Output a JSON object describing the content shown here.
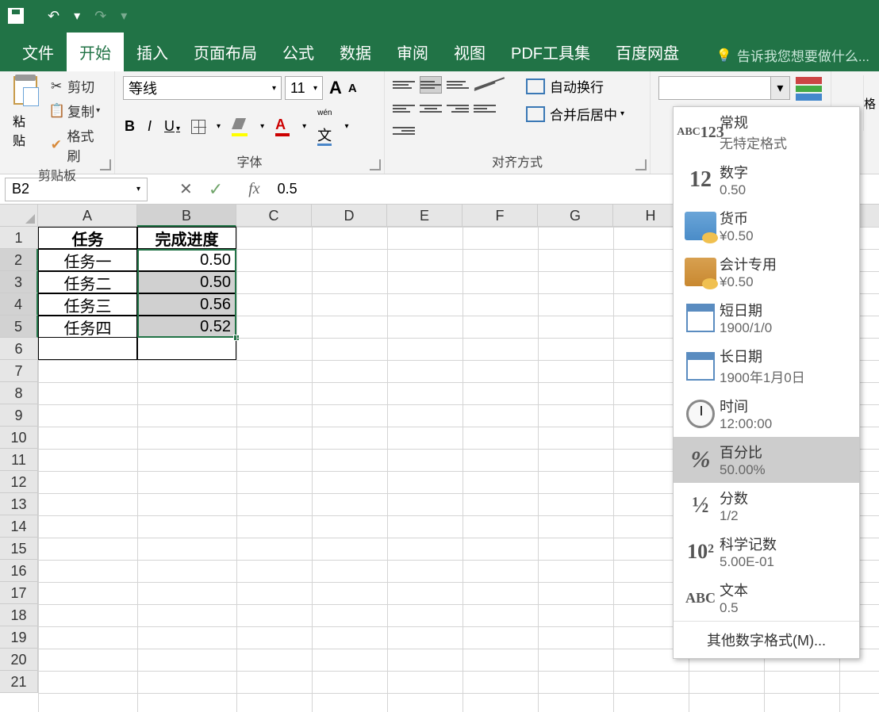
{
  "titlebar": {
    "undo_symbol": "↶",
    "redo_symbol": "↷"
  },
  "menu": {
    "file": "文件",
    "home": "开始",
    "insert": "插入",
    "layout": "页面布局",
    "formulas": "公式",
    "data": "数据",
    "review": "审阅",
    "view": "视图",
    "pdf": "PDF工具集",
    "baidu": "百度网盘",
    "tellme": "告诉我您想要做什么..."
  },
  "ribbon": {
    "clipboard": {
      "paste": "粘贴",
      "cut": "剪切",
      "copy": "复制",
      "format_painter": "格式刷",
      "label": "剪贴板"
    },
    "font": {
      "name": "等线",
      "size": "11",
      "label": "字体"
    },
    "alignment": {
      "wrap": "自动换行",
      "merge": "合并后居中",
      "label": "对齐方式"
    },
    "style_label": "格"
  },
  "namebox": "B2",
  "formula_value": "0.5",
  "columns": [
    "A",
    "B",
    "C",
    "D",
    "E",
    "F",
    "G",
    "H"
  ],
  "rows": [
    "1",
    "2",
    "3",
    "4",
    "5",
    "6",
    "7",
    "8",
    "9",
    "10",
    "11",
    "12",
    "13",
    "14",
    "15",
    "16",
    "17",
    "18",
    "19",
    "20",
    "21"
  ],
  "table": {
    "header_a": "任务",
    "header_b": "完成进度",
    "rows": [
      {
        "a": "任务一",
        "b": "0.50"
      },
      {
        "a": "任务二",
        "b": "0.50"
      },
      {
        "a": "任务三",
        "b": "0.56"
      },
      {
        "a": "任务四",
        "b": "0.52"
      }
    ]
  },
  "format_dropdown": {
    "general": {
      "title": "常规",
      "sub": "无特定格式",
      "icon": "ABC\n123"
    },
    "number": {
      "title": "数字",
      "sub": "0.50",
      "icon": "12"
    },
    "currency": {
      "title": "货币",
      "sub": "¥0.50"
    },
    "accounting": {
      "title": "会计专用",
      "sub": "¥0.50"
    },
    "short_date": {
      "title": "短日期",
      "sub": "1900/1/0"
    },
    "long_date": {
      "title": "长日期",
      "sub": "1900年1月0日"
    },
    "time": {
      "title": "时间",
      "sub": "12:00:00"
    },
    "percentage": {
      "title": "百分比",
      "sub": "50.00%",
      "icon": "%"
    },
    "fraction": {
      "title": "分数",
      "sub": "1/2",
      "icon": "½"
    },
    "scientific": {
      "title": "科学记数",
      "sub": "5.00E-01",
      "icon": "10²"
    },
    "text": {
      "title": "文本",
      "sub": "0.5",
      "icon": "ABC"
    },
    "more": "其他数字格式(M)..."
  }
}
